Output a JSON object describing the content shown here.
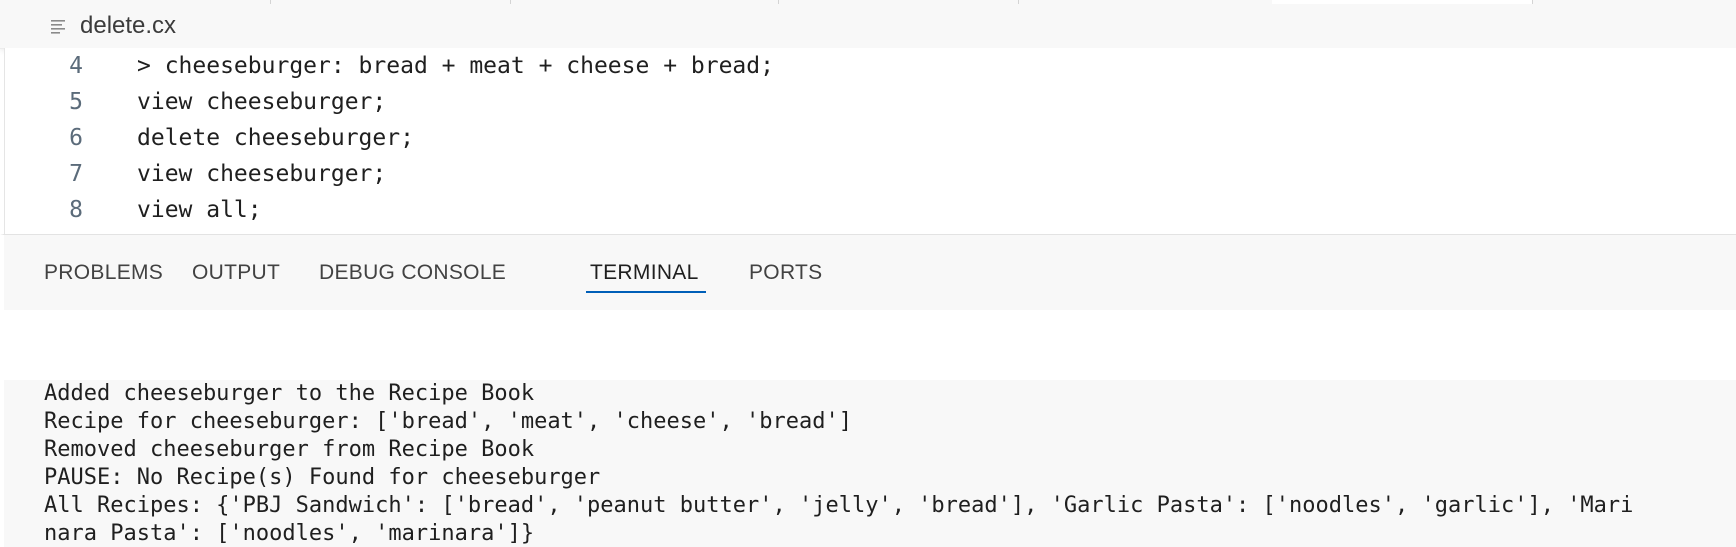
{
  "tab": {
    "file_name": "delete.cx",
    "icon": "lines-icon"
  },
  "editor": {
    "lines": [
      {
        "num": "4",
        "text": "> cheeseburger: bread + meat + cheese + bread;"
      },
      {
        "num": "5",
        "text": "view cheeseburger;"
      },
      {
        "num": "6",
        "text": "delete cheeseburger;"
      },
      {
        "num": "7",
        "text": "view cheeseburger;"
      },
      {
        "num": "8",
        "text": "view all;"
      }
    ]
  },
  "panel": {
    "tabs": [
      {
        "label": "PROBLEMS"
      },
      {
        "label": "OUTPUT"
      },
      {
        "label": "DEBUG CONSOLE"
      },
      {
        "label": "TERMINAL",
        "active": true
      },
      {
        "label": "PORTS"
      }
    ]
  },
  "terminal": {
    "lines": [
      "Added cheeseburger to the Recipe Book",
      "Recipe for cheeseburger: ['bread', 'meat', 'cheese', 'bread']",
      "Removed cheeseburger from Recipe Book",
      "PAUSE: No Recipe(s) Found for cheeseburger",
      "All Recipes: {'PBJ Sandwich': ['bread', 'peanut butter', 'jelly', 'bread'], 'Garlic Pasta': ['noodles', 'garlic'], 'Mari",
      "nara Pasta': ['noodles', 'marinara']}"
    ]
  },
  "colors": {
    "accent": "#005fb8",
    "panel_bg": "#f8f8f8",
    "text": "#1f1f1f"
  }
}
